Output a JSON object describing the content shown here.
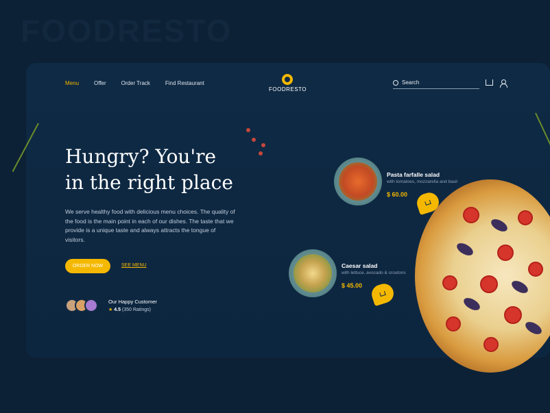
{
  "brand": {
    "watermark": "FOODRESTO",
    "logo_word": "FOODRESTO",
    "accent_color": "#f5b800"
  },
  "nav": {
    "items": [
      "Menu",
      "Offer",
      "Order Track",
      "Find Restaurant"
    ],
    "active_index": 0
  },
  "search": {
    "placeholder": "Search",
    "icon": "search-icon"
  },
  "header_icons": [
    "cart-icon",
    "user-icon"
  ],
  "hero": {
    "title_line1": "Hungry? You're",
    "title_line2": "in the right place",
    "text": "We serve healthy food with delicious menu choices. The quality of the food is the main point in each of our dishes. The taste that we provide is a unique taste and always attracts the tongue of visitors.",
    "order_button": "ORDER NOW",
    "see_menu": "SEE MENU"
  },
  "customers": {
    "label": "Our Happy Customer",
    "rating": "4.5",
    "ratings_count": "(350 Ratings)"
  },
  "dishes": [
    {
      "name": "Pasta farfalle salad",
      "description": "with tomatoes, mozzarella and basil",
      "price": "$ 60.00"
    },
    {
      "name": "Caesar salad",
      "description": "with lettuce, avocado & croutons",
      "price": "$ 45.00"
    }
  ]
}
